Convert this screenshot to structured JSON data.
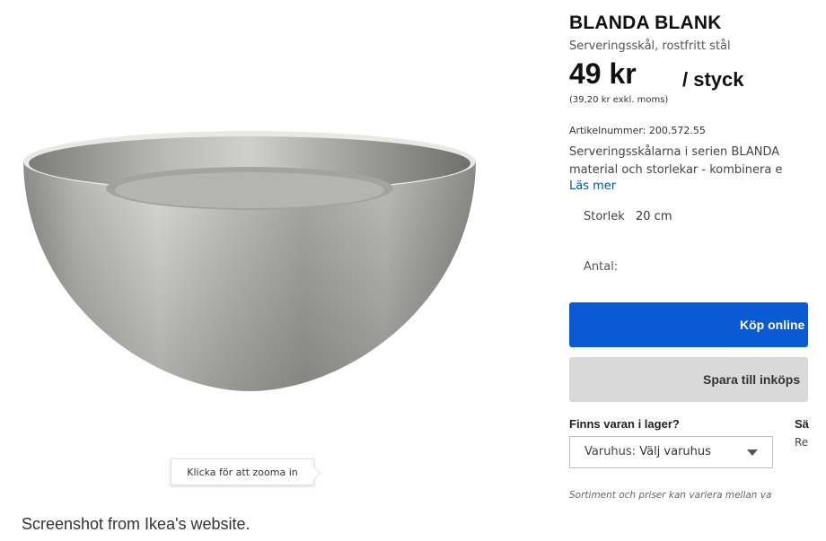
{
  "product": {
    "name": "BLANDA BLANK",
    "subtitle": "Serveringsskål, rostfritt stål",
    "price": "49 kr",
    "unit": "/ styck",
    "price_ex_vat": "(39,20 kr exkl. moms)",
    "article_number": "Artikelnummer: 200.572.55",
    "description_line1": "Serveringsskålarna i serien BLANDA",
    "description_line2": "material och storlekar - kombinera e",
    "read_more": "Läs mer"
  },
  "size": {
    "label": "Storlek",
    "value": "20 cm"
  },
  "quantity": {
    "label": "Antal:"
  },
  "buttons": {
    "buy_online": "Köp online",
    "save_to_list": "Spara till inköps"
  },
  "stock": {
    "question": "Finns varan i lager?",
    "store_label": "Varuhus:",
    "store_value": "Välj varuhus",
    "cut_heading": "Sä",
    "cut_text": "Re"
  },
  "disclaimer": "Sortiment och priser kan variera mellan va",
  "zoom_hint": "Klicka för att zooma in",
  "caption": "Screenshot from Ikea's website.",
  "colors": {
    "primary_button": "#0a5ad4",
    "secondary_button": "#d9d9d9",
    "link": "#0058a3"
  },
  "icons": {
    "dropdown": "chevron-down-icon"
  }
}
